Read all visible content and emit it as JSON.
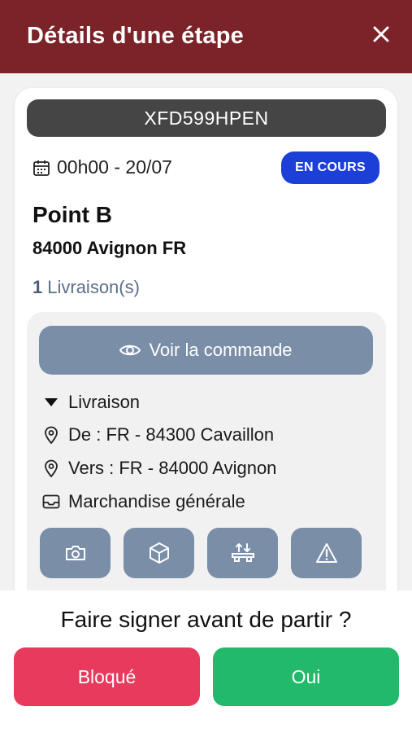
{
  "header": {
    "title": "Détails d'une étape",
    "close_icon": "close-icon"
  },
  "stop": {
    "vehicle_plate": "XFD599HPEN",
    "datetime": "00h00 - 20/07",
    "status": "EN COURS",
    "point_name": "Point B",
    "address": "84000 Avignon FR",
    "delivery_count": "1",
    "delivery_label": "Livraison(s)"
  },
  "order": {
    "view_button_label": "Voir la commande",
    "type": "Livraison",
    "from": "De : FR - 84300 Cavaillon",
    "to": "Vers : FR - 84000 Avignon",
    "goods": "Marchandise générale",
    "actions": [
      "camera-icon",
      "package-icon",
      "unload-icon",
      "warning-icon"
    ]
  },
  "footer": {
    "question": "Faire signer avant de partir ?",
    "blocked_label": "Bloqué",
    "yes_label": "Oui"
  },
  "colors": {
    "header_bg": "#7b2328",
    "status_badge": "#1c3fd8",
    "action_bg": "#7a8ea8",
    "blocked_bg": "#e83a5c",
    "yes_bg": "#22b96a"
  }
}
